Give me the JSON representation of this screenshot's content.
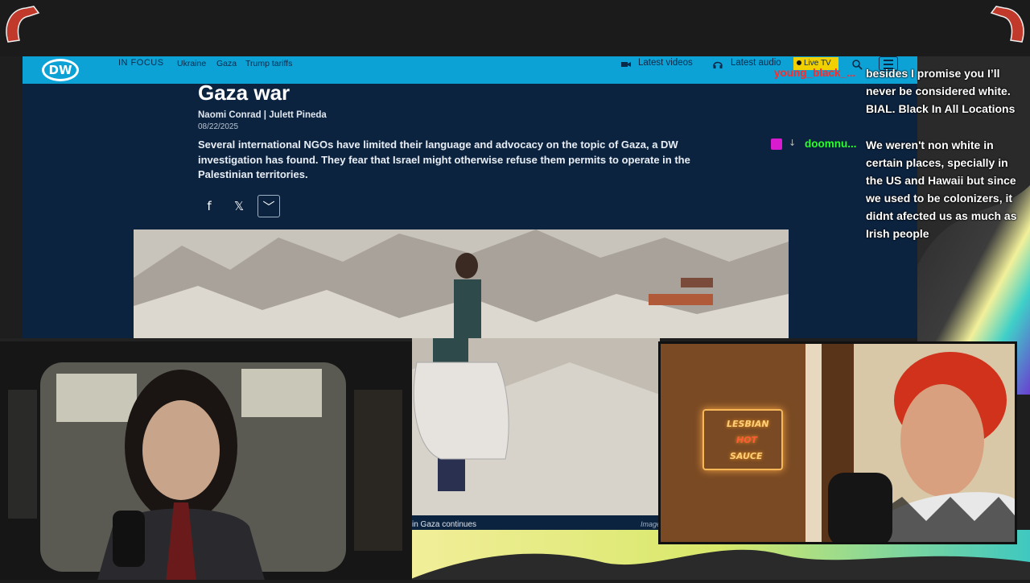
{
  "nav": {
    "logo": "DW",
    "in_focus": "IN FOCUS",
    "links": [
      "Ukraine",
      "Gaza",
      "Trump tariffs"
    ],
    "latest_videos": "Latest videos",
    "latest_audio": "Latest audio",
    "live_tv": "Live TV"
  },
  "article": {
    "title": "Gaza war",
    "author1": "Naomi Conrad",
    "separator": "|",
    "author2": "Julett Pineda",
    "date": "08/22/2025",
    "lead": "Several international NGOs have limited their language and advocacy on the topic of Gaza, a DW investigation has found. They fear that Israel might otherwise refuse them permits to operate in the Palestinian territories.",
    "caption": "in Gaza continues",
    "caption_credit": "Image"
  },
  "share": {
    "facebook": "f",
    "x": "𝕏",
    "more": "﹀"
  },
  "chat": {
    "user1": "young_black_...",
    "user1_color": "#ff2a2a",
    "msg1": "besides I promise you I’ll never be considered white. BIAL. Black In All Locations",
    "user2": "doomnu...",
    "user2_color": "#2aff2a",
    "msg2": "We weren't non white in certain places, specially in the US and Hawaii but since we used to be colonizers, it didnt afected us as much as Irish people"
  },
  "neon_sign": {
    "line1": "LESBIAN",
    "line2": "HOT",
    "line3": "SAUCE"
  },
  "colors": {
    "dw_blue": "#0da2d6",
    "page_bg": "#0c2340",
    "live_tv": "#f0d000",
    "badge": "#d81bce"
  }
}
